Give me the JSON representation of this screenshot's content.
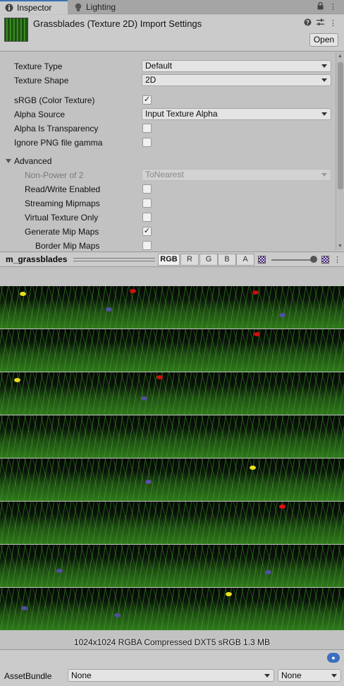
{
  "tabs": [
    {
      "label": "Inspector",
      "icon": "info-icon"
    },
    {
      "label": "Lighting",
      "icon": "lightbulb-icon"
    }
  ],
  "header": {
    "title": "Grassblades (Texture 2D) Import Settings",
    "open_label": "Open"
  },
  "settings": {
    "texture_type": {
      "label": "Texture Type",
      "value": "Default"
    },
    "texture_shape": {
      "label": "Texture Shape",
      "value": "2D"
    },
    "srgb": {
      "label": "sRGB (Color Texture)",
      "checked": "✓"
    },
    "alpha_source": {
      "label": "Alpha Source",
      "value": "Input Texture Alpha"
    },
    "alpha_transparency": {
      "label": "Alpha Is Transparency",
      "checked": ""
    },
    "ignore_png_gamma": {
      "label": "Ignore PNG file gamma",
      "checked": ""
    },
    "advanced": {
      "label": "Advanced"
    },
    "non_power_of_2": {
      "label": "Non-Power of 2",
      "value": "ToNearest"
    },
    "read_write": {
      "label": "Read/Write Enabled",
      "checked": ""
    },
    "streaming_mipmaps": {
      "label": "Streaming Mipmaps",
      "checked": ""
    },
    "virtual_texture": {
      "label": "Virtual Texture Only",
      "checked": ""
    },
    "generate_mipmaps": {
      "label": "Generate Mip Maps",
      "checked": "✓"
    },
    "border_mipmaps": {
      "label": "Border Mip Maps",
      "checked": ""
    }
  },
  "preview": {
    "name": "m_grassblades",
    "channels": [
      "RGB",
      "R",
      "G",
      "B",
      "A"
    ],
    "active_channel": "RGB",
    "info": "1024x1024  RGBA Compressed DXT5 sRGB  1.3 MB"
  },
  "asset_bundle": {
    "label": "AssetBundle",
    "name_value": "None",
    "variant_value": "None"
  }
}
